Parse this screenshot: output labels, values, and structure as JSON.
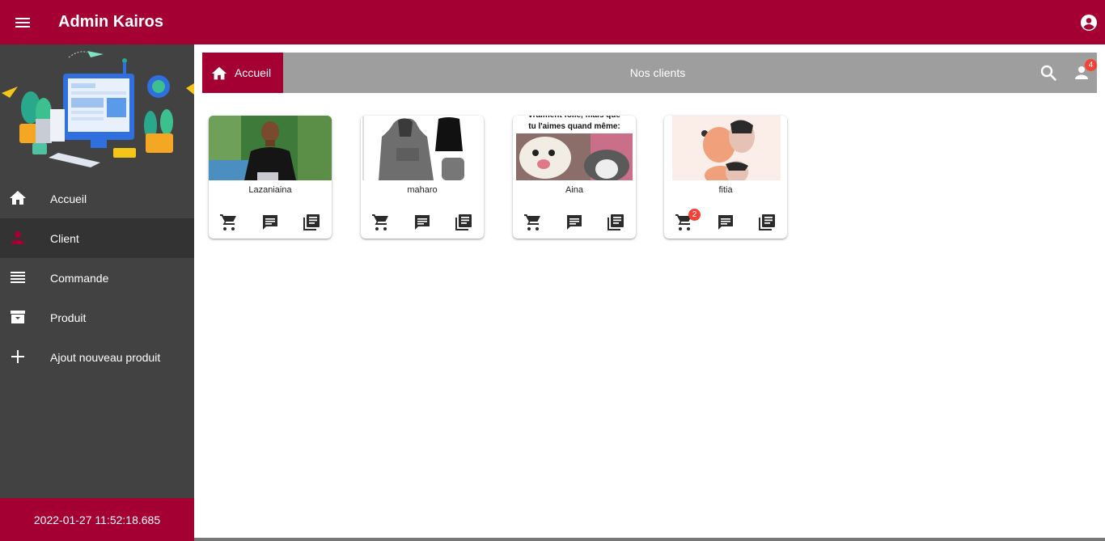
{
  "app": {
    "title": "Admin Kairos"
  },
  "sidebar": {
    "items": [
      {
        "label": "Accueil",
        "icon": "home-icon",
        "active": false
      },
      {
        "label": "Client",
        "icon": "person-icon",
        "active": true
      },
      {
        "label": "Commande",
        "icon": "list-icon",
        "active": false
      },
      {
        "label": "Produit",
        "icon": "archive-icon",
        "active": false
      },
      {
        "label": "Ajout nouveau produit",
        "icon": "plus-icon",
        "active": false
      }
    ],
    "datetime": "2022-01-27 11:52:18.685"
  },
  "toolbar": {
    "home_label": "Accueil",
    "title": "Nos clients",
    "notification_count": "4"
  },
  "clients": [
    {
      "name": "Lazaniaina",
      "cart_badge": ""
    },
    {
      "name": "maharo",
      "cart_badge": ""
    },
    {
      "name": "Aina",
      "cart_badge": "",
      "image_caption": "vraiment folle, mais que\ntu l'aimes quand même:"
    },
    {
      "name": "fitia",
      "cart_badge": "2"
    }
  ],
  "colors": {
    "primary": "#a50034",
    "sidebar": "#424242",
    "sidebar_active": "#333333",
    "toolbar": "#9e9e9e",
    "badge": "#f44336",
    "active_icon": "#a50034"
  }
}
